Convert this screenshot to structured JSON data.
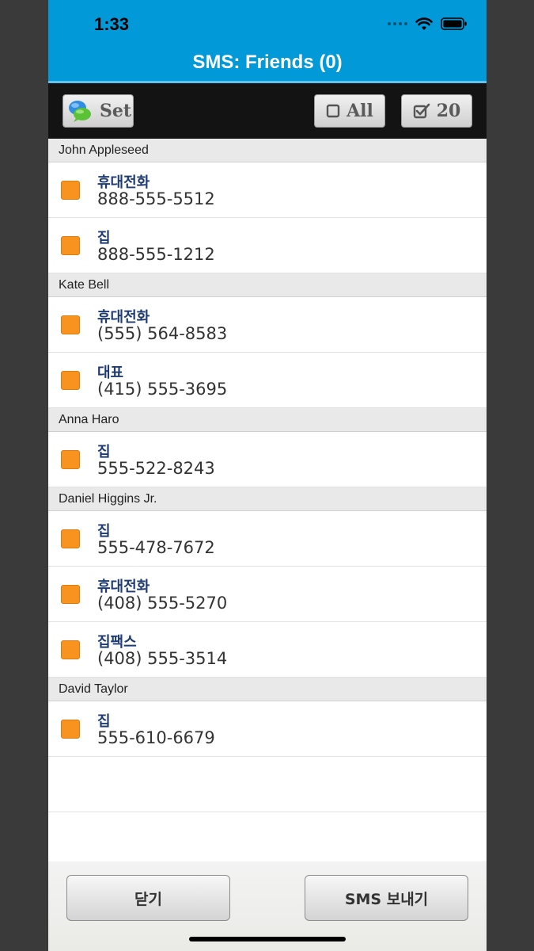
{
  "status_bar": {
    "time": "1:33"
  },
  "nav": {
    "title": "SMS: Friends (0)"
  },
  "toolbar": {
    "set_label": "Set",
    "all_label": "All",
    "count_label": "20"
  },
  "contacts": [
    {
      "name": "John Appleseed",
      "numbers": [
        {
          "type": "휴대전화",
          "phone": "888-555-5512"
        },
        {
          "type": "집",
          "phone": "888-555-1212"
        }
      ]
    },
    {
      "name": "Kate Bell",
      "numbers": [
        {
          "type": "휴대전화",
          "phone": "(555) 564-8583"
        },
        {
          "type": "대표",
          "phone": "(415) 555-3695"
        }
      ]
    },
    {
      "name": "Anna Haro",
      "numbers": [
        {
          "type": "집",
          "phone": "555-522-8243"
        }
      ]
    },
    {
      "name": "Daniel Higgins Jr.",
      "numbers": [
        {
          "type": "집",
          "phone": "555-478-7672"
        },
        {
          "type": "휴대전화",
          "phone": "(408) 555-5270"
        },
        {
          "type": "집팩스",
          "phone": "(408) 555-3514"
        }
      ]
    },
    {
      "name": "David Taylor",
      "numbers": [
        {
          "type": "집",
          "phone": "555-610-6679"
        }
      ]
    }
  ],
  "bottom_bar": {
    "close_label": "닫기",
    "send_label": "SMS 보내기"
  },
  "colors": {
    "nav_blue": "#0199d8",
    "checkbox_orange": "#f7931e",
    "type_text": "#1f3b73"
  },
  "icons": {
    "set": "chat-bubbles-icon",
    "all": "empty-checkbox-icon",
    "count": "checked-checkbox-icon"
  }
}
